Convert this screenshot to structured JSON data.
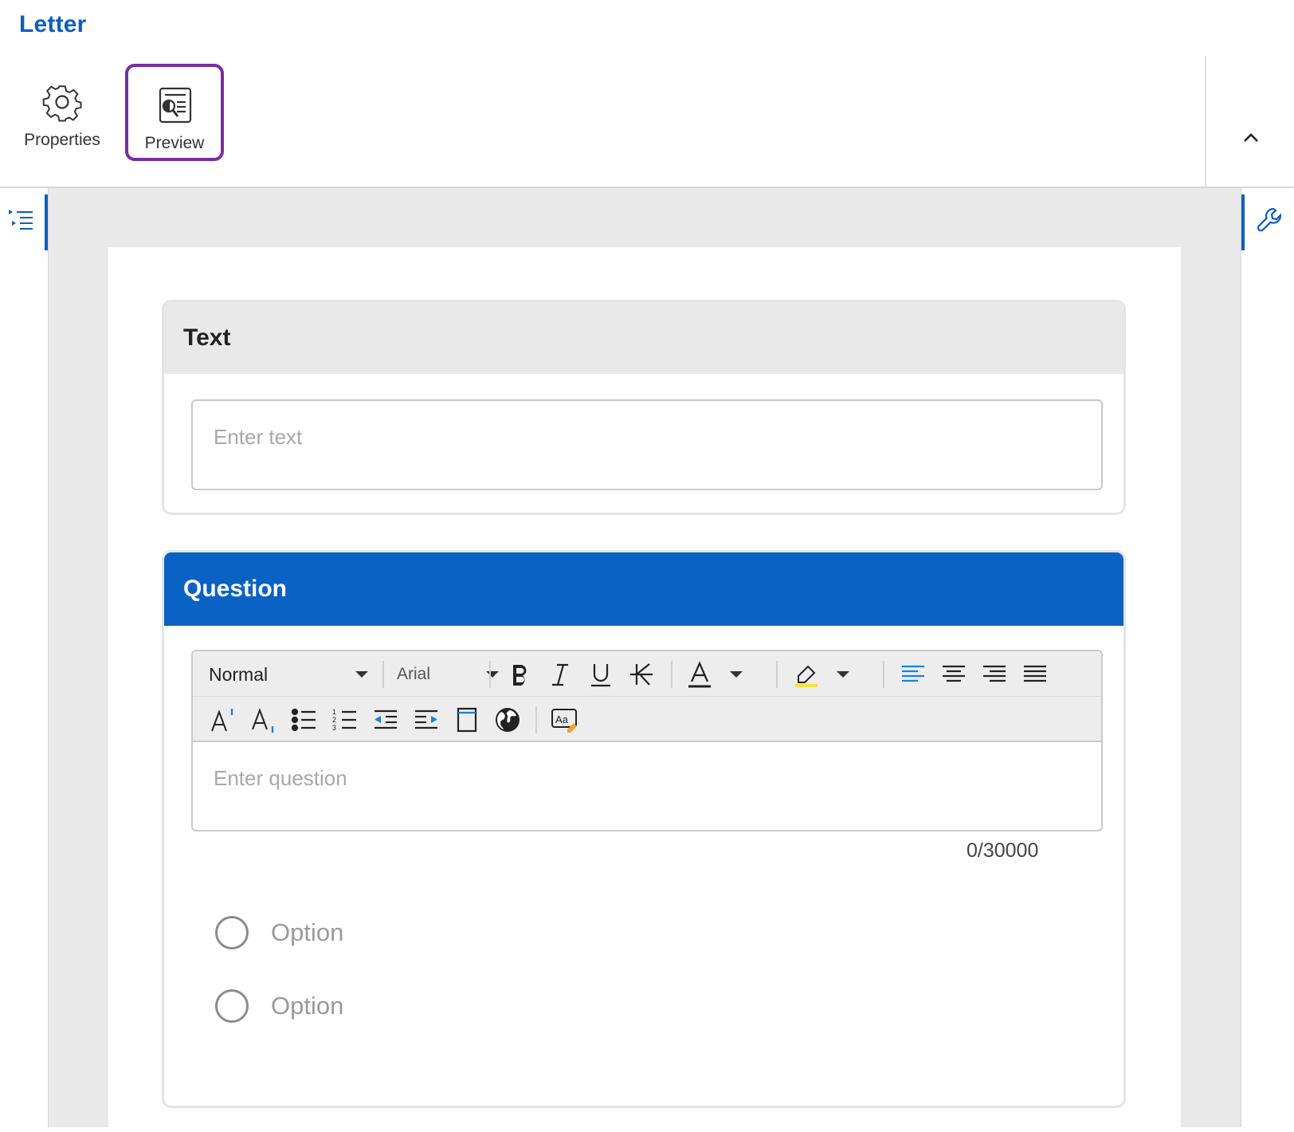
{
  "app": {
    "title": "Letter"
  },
  "ribbon": {
    "properties_label": "Properties",
    "preview_label": "Preview"
  },
  "colors": {
    "accent": "#0a5fc2",
    "selected_outline": "#7b2ca0",
    "question_header": "#0a62c4"
  },
  "text_block": {
    "title": "Text",
    "placeholder": "Enter text"
  },
  "question_block": {
    "title": "Question",
    "toolbar": {
      "style_select": "Normal",
      "font_select": "Arial"
    },
    "placeholder": "Enter question",
    "char_counter": "0/30000",
    "options": [
      "Option",
      "Option"
    ]
  },
  "icons": {
    "ribbon": [
      "gear-icon",
      "preview-icon",
      "chevron-up-icon"
    ],
    "rails": [
      "outline-list-icon",
      "wrench-icon"
    ],
    "toolbar": [
      "bold-icon",
      "italic-icon",
      "underline-icon",
      "strikethrough-icon",
      "font-color-icon",
      "highlight-icon",
      "align-left-icon",
      "align-center-icon",
      "align-right-icon",
      "justify-icon",
      "superscript-icon",
      "subscript-icon",
      "bullet-list-icon",
      "numbered-list-icon",
      "outdent-icon",
      "indent-icon",
      "page-break-icon",
      "globe-icon",
      "special-char-icon"
    ]
  }
}
